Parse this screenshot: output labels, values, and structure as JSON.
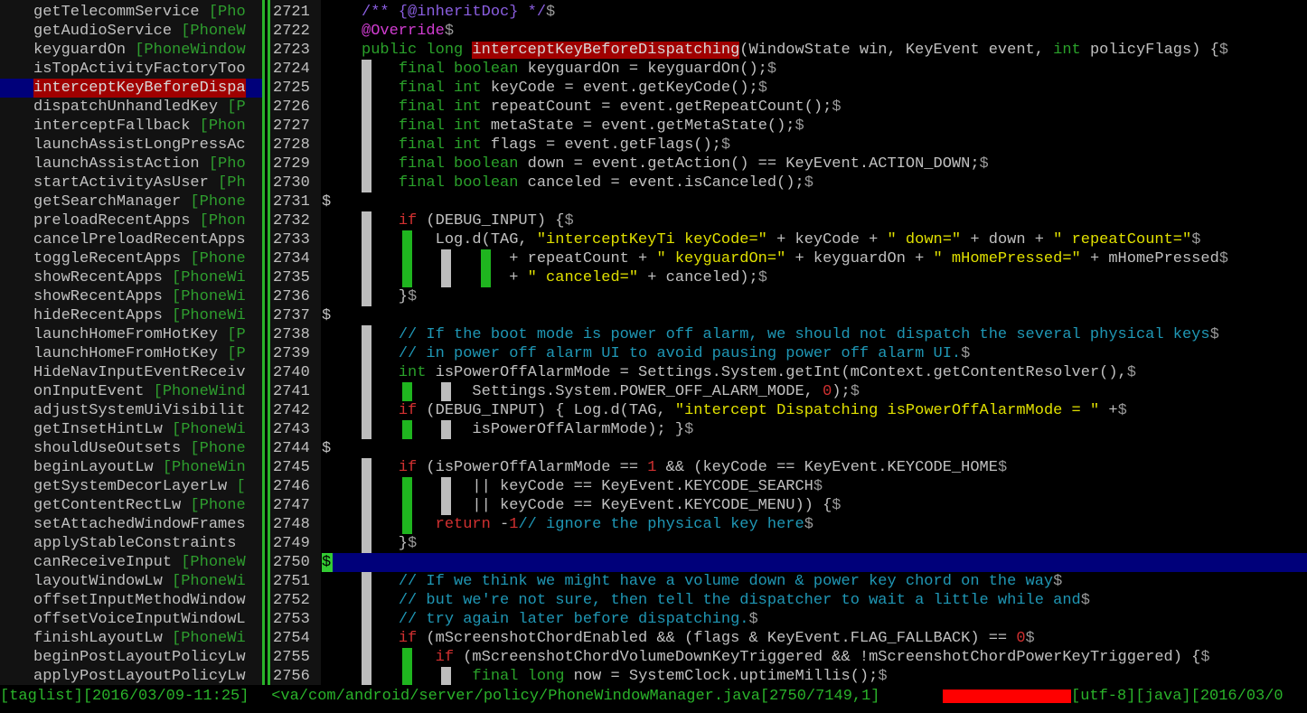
{
  "taglist": {
    "selected_index": 4,
    "items": [
      {
        "line": "2721",
        "name": "getTelecommService",
        "cls": " [Pho"
      },
      {
        "line": "2722",
        "name": "getAudioService",
        "cls": " [PhoneW"
      },
      {
        "line": "2723",
        "name": "keyguardOn",
        "cls": " [PhoneWindow"
      },
      {
        "line": "2724",
        "name": "isTopActivityFactoryToo",
        "cls": ""
      },
      {
        "line": "2725",
        "name": "interceptKeyBeforeDispa",
        "cls": ""
      },
      {
        "line": "2726",
        "name": "dispatchUnhandledKey",
        "cls": " [P"
      },
      {
        "line": "2727",
        "name": "interceptFallback",
        "cls": " [Phon"
      },
      {
        "line": "2728",
        "name": "launchAssistLongPressAc",
        "cls": ""
      },
      {
        "line": "2729",
        "name": "launchAssistAction",
        "cls": " [Pho"
      },
      {
        "line": "2730",
        "name": "startActivityAsUser",
        "cls": " [Ph"
      },
      {
        "line": "2731",
        "name": "getSearchManager",
        "cls": " [Phone"
      },
      {
        "line": "2732",
        "name": "preloadRecentApps",
        "cls": " [Phon"
      },
      {
        "line": "2733",
        "name": "cancelPreloadRecentApps",
        "cls": ""
      },
      {
        "line": "2734",
        "name": "toggleRecentApps",
        "cls": " [Phone"
      },
      {
        "line": "2735",
        "name": "showRecentApps",
        "cls": " [PhoneWi"
      },
      {
        "line": "2736",
        "name": "showRecentApps",
        "cls": " [PhoneWi"
      },
      {
        "line": "2737",
        "name": "hideRecentApps",
        "cls": " [PhoneWi"
      },
      {
        "line": "2738",
        "name": "launchHomeFromHotKey",
        "cls": " [P"
      },
      {
        "line": "2739",
        "name": "launchHomeFromHotKey",
        "cls": " [P"
      },
      {
        "line": "2740",
        "name": "HideNavInputEventReceiv",
        "cls": ""
      },
      {
        "line": "2741",
        "name": "onInputEvent",
        "cls": " [PhoneWind"
      },
      {
        "line": "2742",
        "name": "adjustSystemUiVisibilit",
        "cls": ""
      },
      {
        "line": "2743",
        "name": "getInsetHintLw",
        "cls": " [PhoneWi"
      },
      {
        "line": "2744",
        "name": "shouldUseOutsets",
        "cls": " [Phone"
      },
      {
        "line": "2745",
        "name": "beginLayoutLw",
        "cls": " [PhoneWin"
      },
      {
        "line": "2746",
        "name": "getSystemDecorLayerLw",
        "cls": " ["
      },
      {
        "line": "2747",
        "name": "getContentRectLw",
        "cls": " [Phone"
      },
      {
        "line": "2748",
        "name": "setAttachedWindowFrames",
        "cls": ""
      },
      {
        "line": "2749",
        "name": "applyStableConstraints",
        "cls": " "
      },
      {
        "line": "2750",
        "name": "canReceiveInput",
        "cls": " [PhoneW"
      },
      {
        "line": "2751",
        "name": "layoutWindowLw",
        "cls": " [PhoneWi"
      },
      {
        "line": "2752",
        "name": "offsetInputMethodWindow",
        "cls": ""
      },
      {
        "line": "2753",
        "name": "offsetVoiceInputWindowL",
        "cls": ""
      },
      {
        "line": "2754",
        "name": "finishLayoutLw",
        "cls": " [PhoneWi"
      },
      {
        "line": "2755",
        "name": "beginPostLayoutPolicyLw",
        "cls": ""
      },
      {
        "line": "2756",
        "name": "applyPostLayoutPolicyLw",
        "cls": ""
      }
    ]
  },
  "editor": {
    "cursor_line": "2750",
    "lines": [
      [
        [
          "doc",
          "/** {@inheritDoc} */"
        ],
        [
          "dol",
          "$"
        ]
      ],
      [
        [
          "ann",
          "@Override"
        ],
        [
          "dol",
          "$"
        ]
      ],
      [
        [
          "kw",
          "public long "
        ],
        [
          "hl",
          "interceptKeyBeforeDispatching"
        ],
        [
          "",
          "(WindowState win, KeyEvent event, "
        ],
        [
          "kw",
          "int"
        ],
        [
          "",
          " policyFlags) {"
        ],
        [
          "dol",
          "$"
        ]
      ],
      [
        [
          "",
          "    "
        ],
        [
          "kw",
          "final boolean"
        ],
        [
          "",
          " keyguardOn = keyguardOn();"
        ],
        [
          "dol",
          "$"
        ]
      ],
      [
        [
          "",
          "    "
        ],
        [
          "kw",
          "final int"
        ],
        [
          "",
          " keyCode = event.getKeyCode();"
        ],
        [
          "dol",
          "$"
        ]
      ],
      [
        [
          "",
          "    "
        ],
        [
          "kw",
          "final int"
        ],
        [
          "",
          " repeatCount = event.getRepeatCount();"
        ],
        [
          "dol",
          "$"
        ]
      ],
      [
        [
          "",
          "    "
        ],
        [
          "kw",
          "final int"
        ],
        [
          "",
          " metaState = event.getMetaState();"
        ],
        [
          "dol",
          "$"
        ]
      ],
      [
        [
          "",
          "    "
        ],
        [
          "kw",
          "final int"
        ],
        [
          "",
          " flags = event.getFlags();"
        ],
        [
          "dol",
          "$"
        ]
      ],
      [
        [
          "",
          "    "
        ],
        [
          "kw",
          "final boolean"
        ],
        [
          "",
          " down = event.getAction() == KeyEvent.ACTION_DOWN;"
        ],
        [
          "dol",
          "$"
        ]
      ],
      [
        [
          "",
          "    "
        ],
        [
          "kw",
          "final boolean"
        ],
        [
          "",
          " canceled = event.isCanceled();"
        ],
        [
          "dol",
          "$"
        ]
      ],
      [],
      [
        [
          "",
          "    "
        ],
        [
          "flow",
          "if"
        ],
        [
          "",
          " (DEBUG_INPUT) {"
        ],
        [
          "dol",
          "$"
        ]
      ],
      [
        [
          "",
          "        Log.d(TAG, "
        ],
        [
          "str",
          "\"interceptKeyTi keyCode=\""
        ],
        [
          "",
          " + keyCode + "
        ],
        [
          "str",
          "\" down=\""
        ],
        [
          "",
          " + down + "
        ],
        [
          "str",
          "\" repeatCount=\""
        ],
        [
          "dol",
          "$"
        ]
      ],
      [
        [
          "",
          "                + repeatCount + "
        ],
        [
          "str",
          "\" keyguardOn=\""
        ],
        [
          "",
          " + keyguardOn + "
        ],
        [
          "str",
          "\" mHomePressed=\""
        ],
        [
          "",
          " + mHomePressed"
        ],
        [
          "dol",
          "$"
        ]
      ],
      [
        [
          "",
          "                + "
        ],
        [
          "str",
          "\" canceled=\""
        ],
        [
          "",
          " + canceled);"
        ],
        [
          "dol",
          "$"
        ]
      ],
      [
        [
          "",
          "    }"
        ],
        [
          "dol",
          "$"
        ]
      ],
      [],
      [
        [
          "",
          "    "
        ],
        [
          "cm",
          "// If the boot mode is power off alarm, we should not dispatch the several physical keys"
        ],
        [
          "dol",
          "$"
        ]
      ],
      [
        [
          "",
          "    "
        ],
        [
          "cm",
          "// in power off alarm UI to avoid pausing power off alarm UI."
        ],
        [
          "dol",
          "$"
        ]
      ],
      [
        [
          "",
          "    "
        ],
        [
          "kw",
          "int"
        ],
        [
          "",
          " isPowerOffAlarmMode = Settings.System.getInt(mContext.getContentResolver(),"
        ],
        [
          "dol",
          "$"
        ]
      ],
      [
        [
          "",
          "            Settings.System.POWER_OFF_ALARM_MODE, "
        ],
        [
          "num",
          "0"
        ],
        [
          "",
          ");"
        ],
        [
          "dol",
          "$"
        ]
      ],
      [
        [
          "",
          "    "
        ],
        [
          "flow",
          "if"
        ],
        [
          "",
          " (DEBUG_INPUT) { Log.d(TAG, "
        ],
        [
          "str",
          "\"intercept Dispatching isPowerOffAlarmMode = \""
        ],
        [
          "",
          " +"
        ],
        [
          "dol",
          "$"
        ]
      ],
      [
        [
          "",
          "            isPowerOffAlarmMode); }"
        ],
        [
          "dol",
          "$"
        ]
      ],
      [],
      [
        [
          "",
          "    "
        ],
        [
          "flow",
          "if"
        ],
        [
          "",
          " (isPowerOffAlarmMode == "
        ],
        [
          "num",
          "1"
        ],
        [
          "",
          " && (keyCode == KeyEvent.KEYCODE_HOME"
        ],
        [
          "dol",
          "$"
        ]
      ],
      [
        [
          "",
          "            || keyCode == KeyEvent.KEYCODE_SEARCH"
        ],
        [
          "dol",
          "$"
        ]
      ],
      [
        [
          "",
          "            || keyCode == KeyEvent.KEYCODE_MENU)) {"
        ],
        [
          "dol",
          "$"
        ]
      ],
      [
        [
          "",
          "        "
        ],
        [
          "flow",
          "return"
        ],
        [
          "",
          " -"
        ],
        [
          "num",
          "1"
        ],
        [
          ";  "
        ],
        [
          "cm",
          "// ignore the physical key here"
        ],
        [
          "dol",
          "$"
        ]
      ],
      [
        [
          "",
          "    }"
        ],
        [
          "dol",
          "$"
        ]
      ],
      [],
      [
        [
          "",
          "    "
        ],
        [
          "cm",
          "// If we think we might have a volume down & power key chord on the way"
        ],
        [
          "dol",
          "$"
        ]
      ],
      [
        [
          "",
          "    "
        ],
        [
          "cm",
          "// but we're not sure, then tell the dispatcher to wait a little while and"
        ],
        [
          "dol",
          "$"
        ]
      ],
      [
        [
          "",
          "    "
        ],
        [
          "cm",
          "// try again later before dispatching."
        ],
        [
          "dol",
          "$"
        ]
      ],
      [
        [
          "",
          "    "
        ],
        [
          "flow",
          "if"
        ],
        [
          "",
          " (mScreenshotChordEnabled && (flags & KeyEvent.FLAG_FALLBACK) == "
        ],
        [
          "num",
          "0"
        ],
        [
          ") {"
        ],
        [
          "dol",
          "$"
        ]
      ],
      [
        [
          "",
          "        "
        ],
        [
          "flow",
          "if"
        ],
        [
          "",
          " (mScreenshotChordVolumeDownKeyTriggered && !mScreenshotChordPowerKeyTriggered) {"
        ],
        [
          "dol",
          "$"
        ]
      ],
      [
        [
          "",
          "            "
        ],
        [
          "kw",
          "final long"
        ],
        [
          "",
          " now = SystemClock.uptimeMillis();"
        ],
        [
          "dol",
          "$"
        ]
      ]
    ]
  },
  "status": {
    "left": "[taglist][2016/03/09-11:25]",
    "file": " <va/com/android/server/policy/PhoneWindowManager.java[2750/7149,1]",
    "right": "[utf-8][java][2016/03/0"
  },
  "colors": {
    "background": "#000000",
    "panel": "#121212",
    "keyword": "#2aa12a",
    "string": "#e0e000",
    "comment": "#1f97b5",
    "highlight": "#a00000",
    "cursorline": "#00007a",
    "guide_white": "#bdbdbd",
    "guide_green": "#1fb51f"
  }
}
